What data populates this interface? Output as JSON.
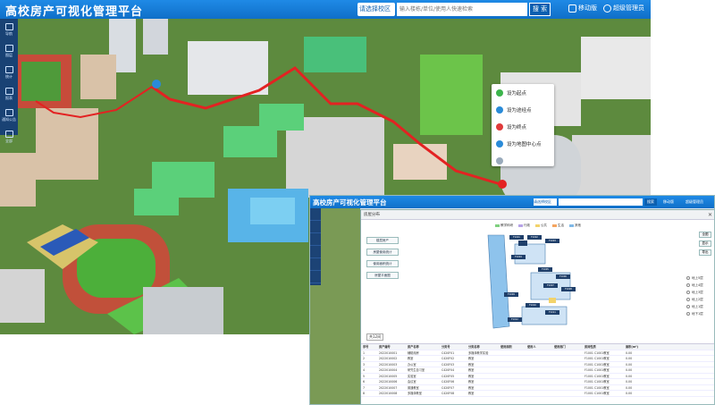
{
  "app": {
    "title": "高校房产可视化管理平台",
    "campus_select": "请选择校区",
    "search_placeholder": "输入楼栋/单位/使用人快速检索",
    "search_button": "搜 索",
    "mobile_label": "移动版",
    "user_label": "超级管理员"
  },
  "sidebar": {
    "items": [
      {
        "label": "导航",
        "icon": "navigation-icon"
      },
      {
        "label": "图层",
        "icon": "layers-icon"
      },
      {
        "label": "统计",
        "icon": "statistics-icon"
      },
      {
        "label": "报表",
        "icon": "report-icon"
      },
      {
        "label": "通知公告",
        "icon": "notice-icon"
      },
      {
        "label": "全部",
        "icon": "all-icon"
      }
    ]
  },
  "context_menu": {
    "items": [
      {
        "label": "设为起点",
        "color": "#3cb44b"
      },
      {
        "label": "设为途经点",
        "color": "#2a8bd8"
      },
      {
        "label": "设为终点",
        "color": "#e03a3a"
      },
      {
        "label": "设为地图中心点",
        "color": "#2a8bd8"
      },
      {
        "label": "",
        "color": "#9ab"
      }
    ]
  },
  "inset": {
    "title": "高校房产可视化管理平台",
    "campus_select": "请选择校区",
    "search_button": "搜索",
    "mobile_label": "移动版",
    "user_label": "超级管理员",
    "dialog_title": "房屋分布",
    "legend": [
      {
        "label": "教学科研",
        "color": "#7fd07f"
      },
      {
        "label": "行政",
        "color": "#b6a3e6"
      },
      {
        "label": "公共",
        "color": "#f2d36b"
      },
      {
        "label": "生活",
        "color": "#f4a460"
      },
      {
        "label": "其他",
        "color": "#7fb8e6"
      }
    ],
    "left_buttons": [
      "楼层房产",
      "房屋使用统计",
      "使用面积统计",
      "房屋平面图"
    ],
    "right_buttons": [
      "全图",
      "显示",
      "导出"
    ],
    "floors": [
      "地上5层",
      "地上4层",
      "地上3层",
      "地上2层",
      "地上1层",
      "地下1层"
    ],
    "room_tags": [
      "F1001",
      "F1002",
      "F1003",
      "F1004",
      "F1005",
      "F1006",
      "F1007",
      "F1008",
      "F1009",
      "F1010",
      "F1011",
      "F1012"
    ],
    "count_label": "共12间",
    "table": {
      "headers": [
        "序号",
        "房产编号",
        "房产名称",
        "分类号",
        "分类名称",
        "使用面积",
        "使用人",
        "使用部门",
        "房间性质",
        "面积(m²)"
      ],
      "rows": [
        [
          "1",
          "2022010001",
          "辅助用房",
          "C420F01",
          "多媒体教学实验",
          "",
          "",
          "",
          "F1001 C1001教室",
          "0.00"
        ],
        [
          "2",
          "2022010002",
          "教室",
          "C420F02",
          "教室",
          "",
          "",
          "",
          "F1001 C1001教室",
          "0.00"
        ],
        [
          "3",
          "2022010003",
          "办公室",
          "C420F03",
          "教室",
          "",
          "",
          "",
          "F1001 C1001教室",
          "0.00"
        ],
        [
          "4",
          "2022010004",
          "研究生自习室",
          "C420F04",
          "教室",
          "",
          "",
          "",
          "F1001 C1001教室",
          "0.00"
        ],
        [
          "5",
          "2022010005",
          "实验室",
          "C420F05",
          "教室",
          "",
          "",
          "",
          "F1001 C1001教室",
          "0.00"
        ],
        [
          "6",
          "2022010006",
          "会议室",
          "C420F06",
          "教室",
          "",
          "",
          "",
          "F1001 C1001教室",
          "0.00"
        ],
        [
          "7",
          "2022010007",
          "普通教室",
          "C420F07",
          "教室",
          "",
          "",
          "",
          "F1001 C1001教室",
          "0.00"
        ],
        [
          "8",
          "2022010008",
          "多媒体教室",
          "C420F08",
          "教室",
          "",
          "",
          "",
          "F1001 C1001教室",
          "0.00"
        ]
      ]
    }
  }
}
